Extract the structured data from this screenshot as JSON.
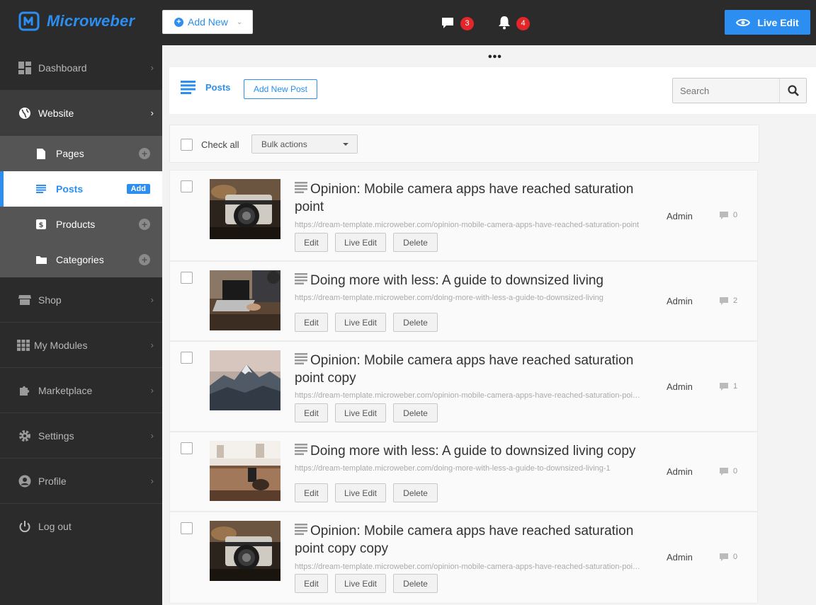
{
  "app": {
    "brand": "Microweber",
    "accent": "#2b8ef0"
  },
  "topbar": {
    "add_new_label": "Add New",
    "comments_count": "3",
    "notifications_count": "4",
    "live_edit_label": "Live Edit"
  },
  "sidebar": {
    "items": [
      {
        "label": "Dashboard",
        "icon": "dashboard-icon"
      },
      {
        "label": "Website",
        "icon": "globe-icon"
      },
      {
        "label": "Shop",
        "icon": "shop-icon"
      },
      {
        "label": "My Modules",
        "icon": "modules-icon"
      },
      {
        "label": "Marketplace",
        "icon": "puzzle-icon"
      },
      {
        "label": "Settings",
        "icon": "gear-icon"
      },
      {
        "label": "Profile",
        "icon": "user-icon"
      },
      {
        "label": "Log out",
        "icon": "power-icon"
      }
    ],
    "website_sub": [
      {
        "label": "Pages"
      },
      {
        "label": "Posts",
        "badge": "Add"
      },
      {
        "label": "Products"
      },
      {
        "label": "Categories"
      }
    ]
  },
  "header": {
    "title": "Posts",
    "add_post_label": "Add New Post",
    "search_placeholder": "Search"
  },
  "bulk": {
    "check_all_label": "Check all",
    "bulk_actions_label": "Bulk actions"
  },
  "row_actions": {
    "edit": "Edit",
    "live_edit": "Live Edit",
    "delete": "Delete"
  },
  "posts": [
    {
      "title": "Opinion: Mobile camera apps have reached saturation point",
      "url": "https://dream-template.microweber.com/opinion-mobile-camera-apps-have-reached-saturation-point",
      "author": "Admin",
      "comments": "0"
    },
    {
      "title": "Doing more with less: A guide to downsized living",
      "url": "https://dream-template.microweber.com/doing-more-with-less-a-guide-to-downsized-living",
      "author": "Admin",
      "comments": "2"
    },
    {
      "title": "Opinion: Mobile camera apps have reached saturation point copy",
      "url": "https://dream-template.microweber.com/opinion-mobile-camera-apps-have-reached-saturation-point-copy",
      "author": "Admin",
      "comments": "1"
    },
    {
      "title": "Doing more with less: A guide to downsized living copy",
      "url": "https://dream-template.microweber.com/doing-more-with-less-a-guide-to-downsized-living-1",
      "author": "Admin",
      "comments": "0"
    },
    {
      "title": "Opinion: Mobile camera apps have reached saturation point copy copy",
      "url": "https://dream-template.microweber.com/opinion-mobile-camera-apps-have-reached-saturation-point-copy-copy",
      "author": "Admin",
      "comments": "0"
    }
  ]
}
